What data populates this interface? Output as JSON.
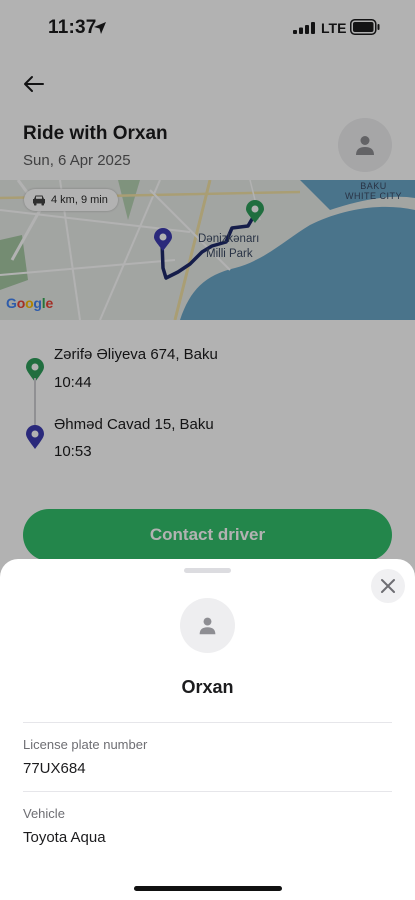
{
  "status_bar": {
    "time": "11:37",
    "network": "LTE"
  },
  "header": {
    "title": "Ride with Orxan",
    "date": "Sun, 6 Apr 2025"
  },
  "map": {
    "distance_duration": "4 km, 9 min",
    "park_label_line1": "Dənizkənarı",
    "park_label_line2": "Milli Park",
    "city_label_line1": "BAKU",
    "city_label_line2": "WHITE CITY",
    "provider": "Google"
  },
  "route": {
    "pickup": {
      "address": "Zərifə Əliyeva 674, Baku",
      "time": "10:44",
      "color": "#2f9e5b"
    },
    "dropoff": {
      "address": "Əhməd Cavad 15, Baku",
      "time": "10:53",
      "color": "#3d3bb0"
    }
  },
  "contact_button": "Contact driver",
  "driver_sheet": {
    "name": "Orxan",
    "license_label": "License plate number",
    "license_value": "77UX684",
    "vehicle_label": "Vehicle",
    "vehicle_value": "Toyota Aqua"
  },
  "colors": {
    "accent": "#33c06c",
    "route_line": "#1f2a6b",
    "water": "#6aa6c8"
  }
}
